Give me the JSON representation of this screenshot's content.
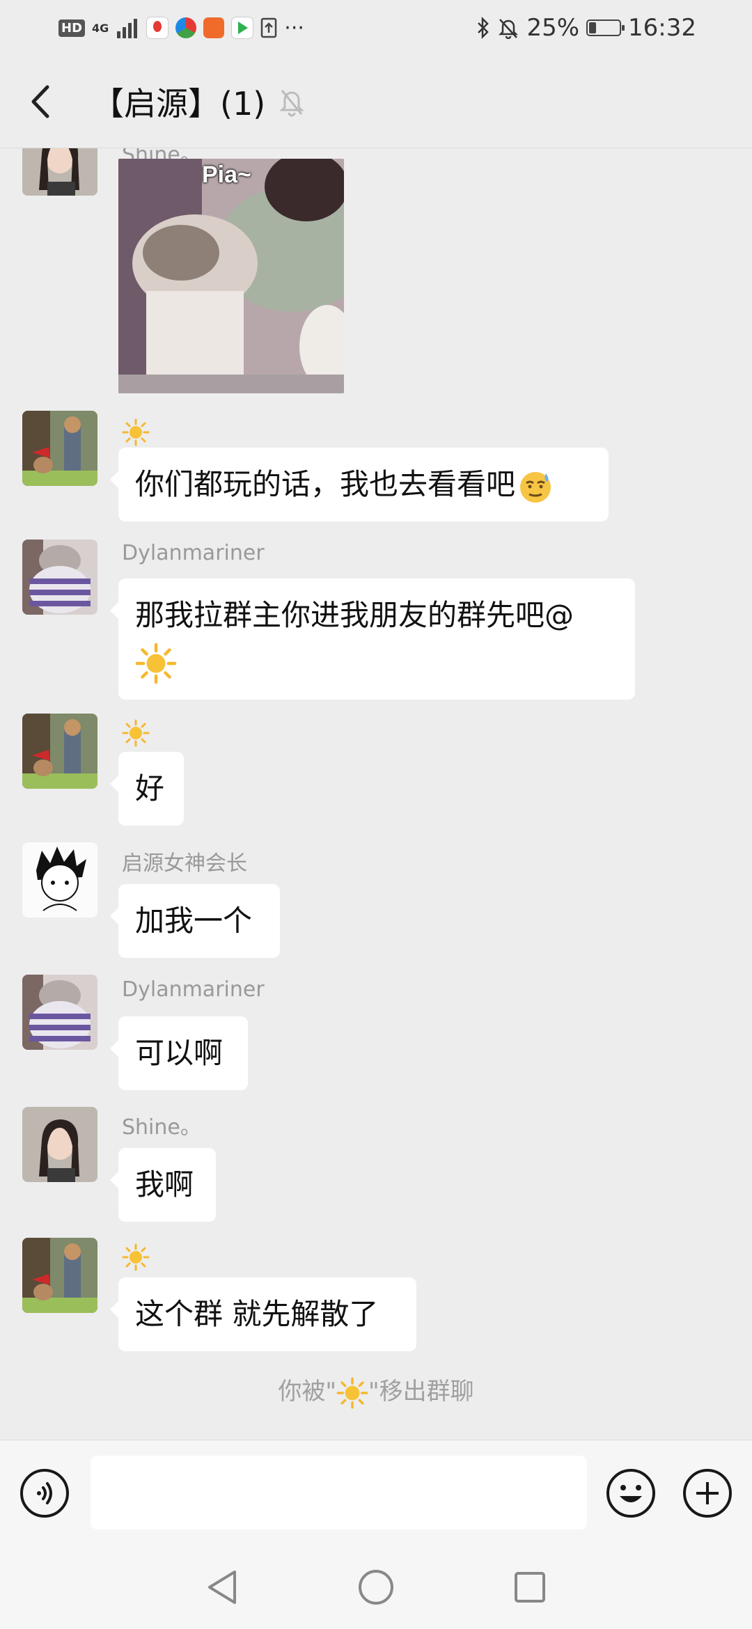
{
  "status_bar": {
    "network": "HD",
    "signal": "4G",
    "battery": "25%",
    "time": "16:32"
  },
  "header": {
    "title": "【启源】(1)"
  },
  "messages": [
    {
      "sender": "Shine。",
      "type": "image",
      "image_text": "Pia~",
      "avatar": "avatar-shine"
    },
    {
      "sender": "☀️",
      "text": "你们都玩的话，我也去看看吧",
      "trailing_emoji": "😓",
      "avatar": "avatar-sun"
    },
    {
      "sender": "Dylanmariner",
      "text": "那我拉群主你进我朋友的群先吧@",
      "line2_emoji": "☀️",
      "avatar": "avatar-dylan"
    },
    {
      "sender": "☀️",
      "text": "好",
      "avatar": "avatar-sun"
    },
    {
      "sender": "启源女神会长",
      "text": "加我一个",
      "avatar": "avatar-goddess"
    },
    {
      "sender": "Dylanmariner",
      "text": "可以啊",
      "avatar": "avatar-dylan"
    },
    {
      "sender": "Shine。",
      "text": "我啊",
      "avatar": "avatar-shine"
    },
    {
      "sender": "☀️",
      "text": "这个群 就先解散了",
      "avatar": "avatar-sun"
    }
  ],
  "system_message": {
    "prefix": "你被\"",
    "suffix": "\"移出群聊"
  },
  "input": {
    "placeholder": ""
  },
  "colors": {
    "background": "#ededed",
    "bubble": "#ffffff",
    "sun": "#f5b82e"
  }
}
